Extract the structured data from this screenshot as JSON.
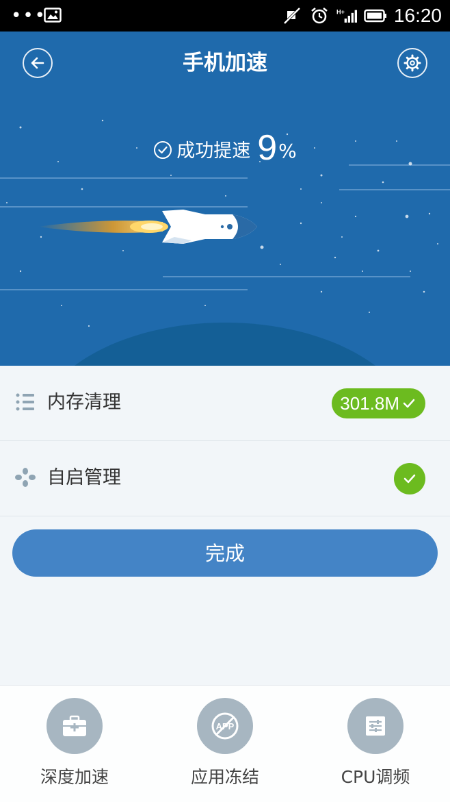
{
  "status_bar": {
    "dots": "•••",
    "time": "16:20",
    "network_label": "H+"
  },
  "header": {
    "title": "手机加速",
    "back_icon": "back-arrow-icon",
    "settings_icon": "gear-icon"
  },
  "result": {
    "label": "成功提速",
    "value": "9",
    "unit": "%"
  },
  "items": [
    {
      "label": "内存清理",
      "badge": "301.8M",
      "icon": "list-icon"
    },
    {
      "label": "自启管理",
      "icon": "fan-icon"
    }
  ],
  "done_button": {
    "label": "完成"
  },
  "tools": [
    {
      "label": "深度加速",
      "icon": "toolbox-icon"
    },
    {
      "label": "应用冻结",
      "icon": "app-blocked-icon"
    },
    {
      "label": "CPU调频",
      "icon": "equalizer-icon"
    }
  ],
  "colors": {
    "hero_blue": "#1f6aac",
    "accent_green": "#6cbb1f",
    "button_blue": "#4484c6",
    "tool_gray": "#a7b6c1"
  }
}
